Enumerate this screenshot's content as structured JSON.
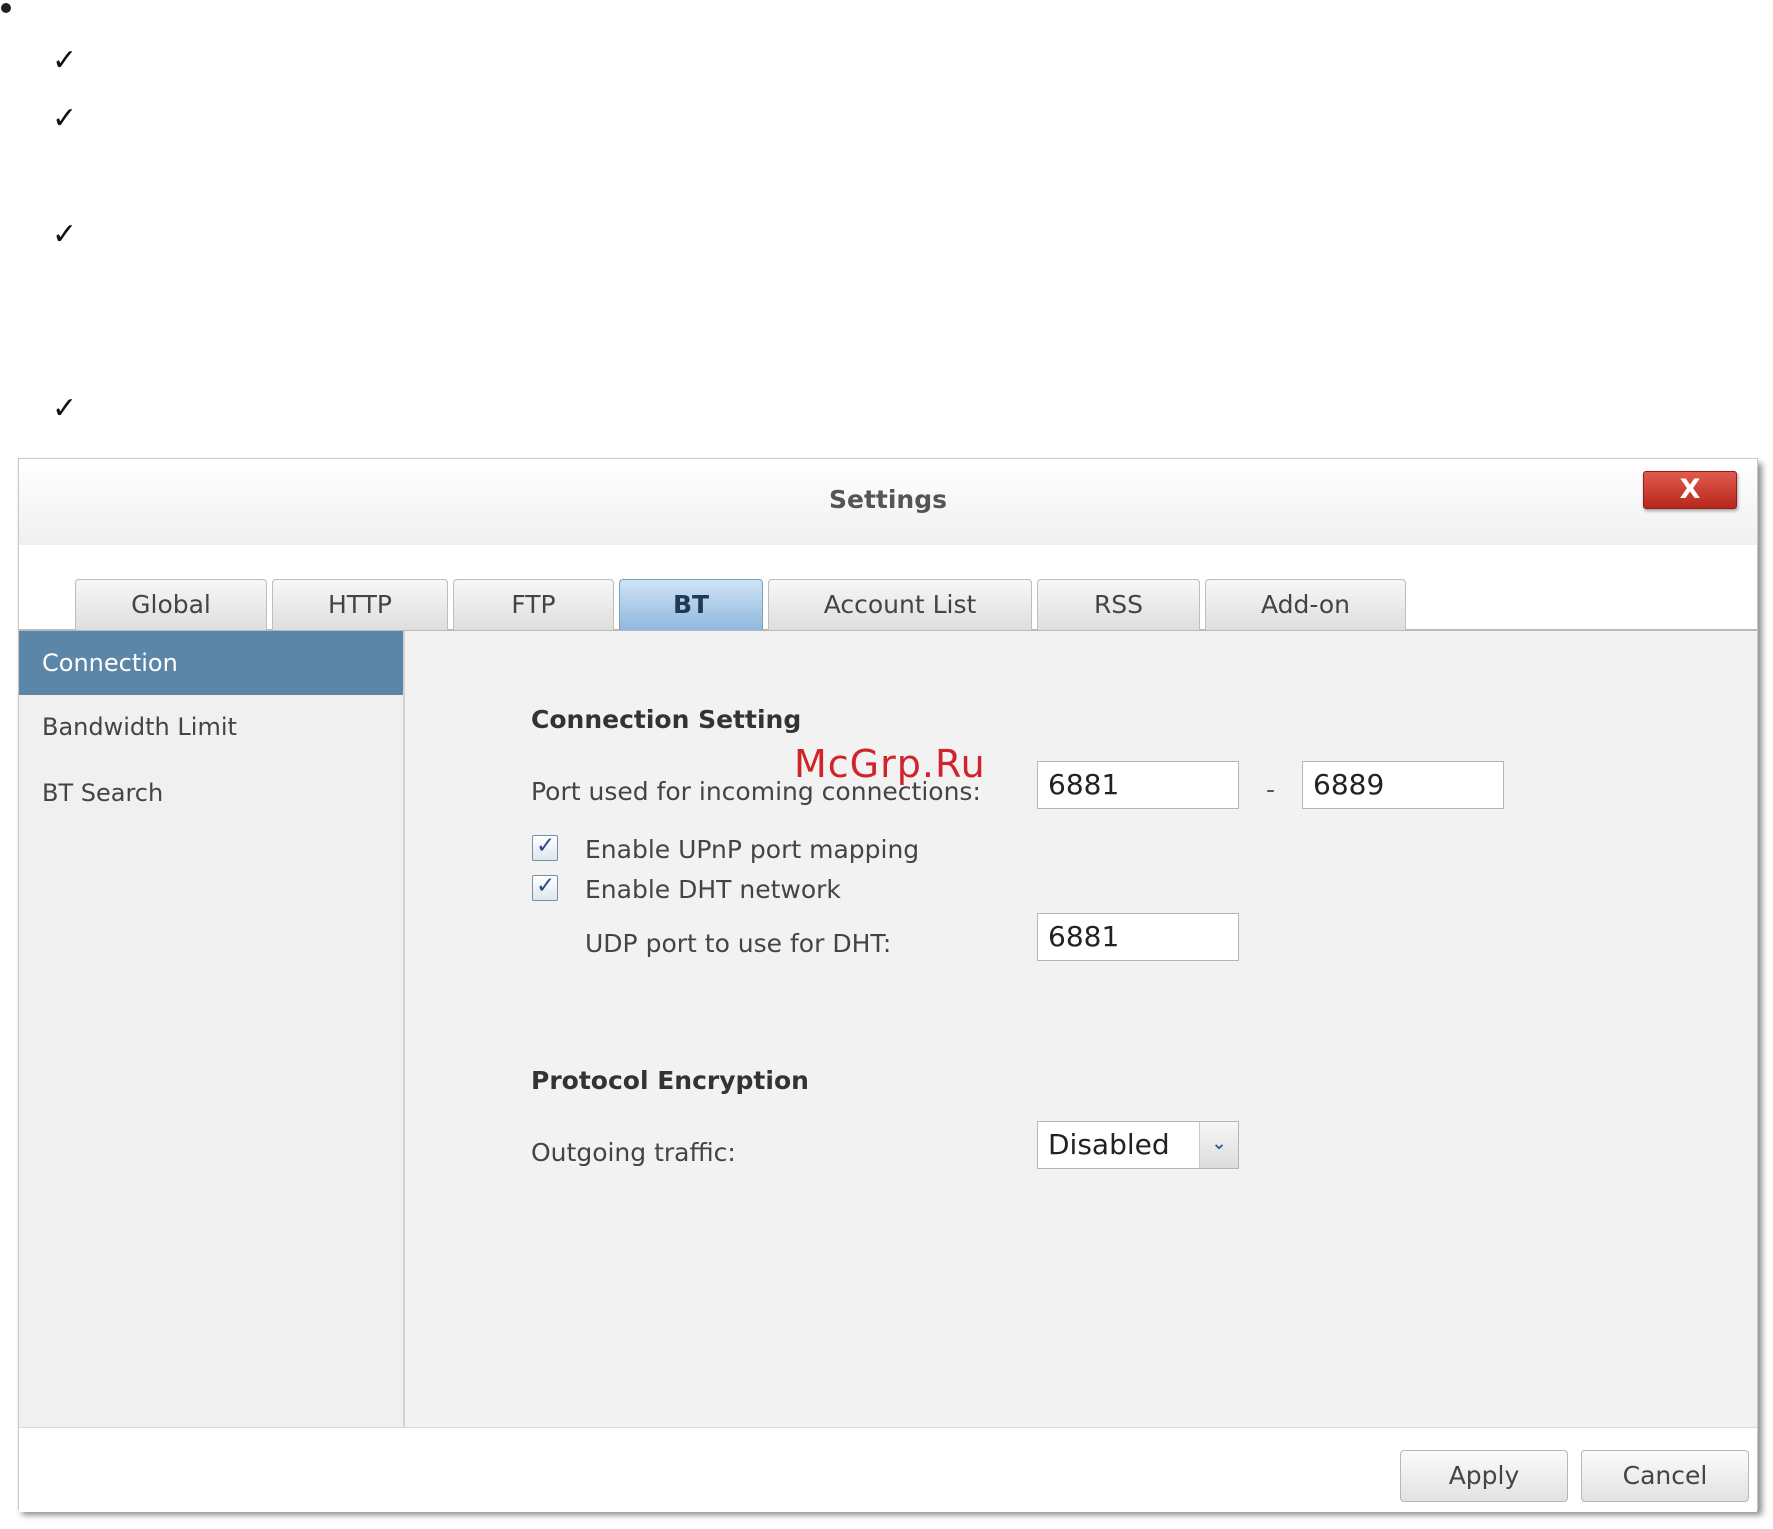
{
  "document": {
    "checkmark_glyph": "✓"
  },
  "dialog": {
    "title": "Settings",
    "close_label": "X",
    "tabs": [
      {
        "label": "Global"
      },
      {
        "label": "HTTP"
      },
      {
        "label": "FTP"
      },
      {
        "label": "BT",
        "active": true
      },
      {
        "label": "Account List"
      },
      {
        "label": "RSS"
      },
      {
        "label": "Add-on"
      }
    ],
    "sidebar": {
      "items": [
        {
          "label": "Connection",
          "active": true
        },
        {
          "label": "Bandwidth Limit"
        },
        {
          "label": "BT Search"
        }
      ]
    },
    "connection_setting": {
      "heading": "Connection Setting",
      "port_label": "Port used for incoming connections:",
      "port_from": "6881",
      "port_separator": "-",
      "port_to": "6889",
      "upnp_label": "Enable UPnP port mapping",
      "upnp_checked": true,
      "dht_label": "Enable DHT network",
      "dht_checked": true,
      "udp_label": "UDP port to use for DHT:",
      "udp_port": "6881"
    },
    "protocol_encryption": {
      "heading": "Protocol Encryption",
      "outgoing_label": "Outgoing traffic:",
      "outgoing_value": "Disabled"
    },
    "footer": {
      "apply_label": "Apply",
      "cancel_label": "Cancel"
    }
  },
  "watermark": "McGrp.Ru",
  "colors": {
    "active_tab": "#8fb8dd",
    "sidebar_active": "#5b86a8",
    "close_button": "#c7382b",
    "watermark": "#d2232a"
  }
}
